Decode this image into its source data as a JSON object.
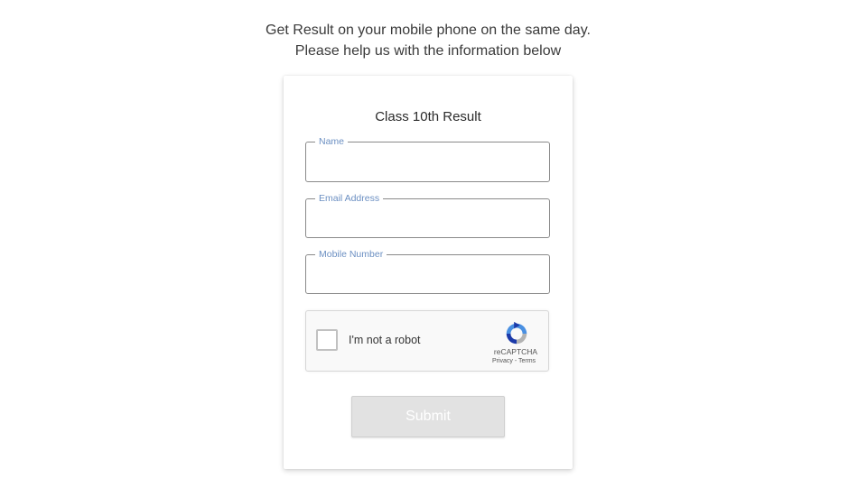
{
  "intro": {
    "line1": "Get Result on your mobile phone on the same day.",
    "line2": "Please help us with the information below"
  },
  "form": {
    "title": "Class 10th Result",
    "fields": [
      {
        "label": "Name",
        "value": ""
      },
      {
        "label": "Email Address",
        "value": ""
      },
      {
        "label": "Mobile Number",
        "value": ""
      }
    ],
    "recaptcha": {
      "label": "I'm not a robot",
      "brand": "reCAPTCHA",
      "privacy": "Privacy",
      "separator": " - ",
      "terms": "Terms",
      "icon": "recaptcha-logo-icon"
    },
    "submit_label": "Submit"
  },
  "colors": {
    "legend": "#6b8fc2",
    "submit_bg": "#e2e2e2",
    "recaptcha_blue": "#4a90e2",
    "recaptcha_dark": "#1c3aa9",
    "recaptcha_gray": "#b3b3b3"
  }
}
